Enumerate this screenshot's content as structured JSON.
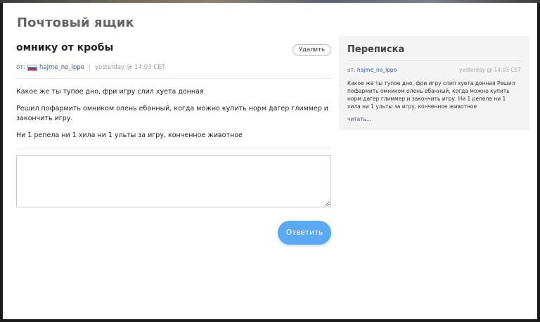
{
  "page": {
    "title": "Почтовый ящик"
  },
  "message": {
    "subject": "омнику от кробы",
    "delete_label": "Удалить",
    "from_label": "от:",
    "author": "hajme_no_ippo",
    "time": "yesterday @ 14:03 CET",
    "paragraphs": [
      "Какое же ты тупое дно, фри игру слил хуета донная",
      "Решил пофармить омником олень ебанный, когда можно купить норм дагер глиммер и закончить игру.",
      "Ни 1 репела ни 1 хила ни 1 ульты за игру, конченное животное"
    ]
  },
  "reply": {
    "text": "",
    "button_label": "Ответить"
  },
  "correspondence": {
    "title": "Переписка",
    "from_label": "от:",
    "author": "hajme_no_ippo",
    "time": "yesterday @ 14:03 CET",
    "preview": "Какое же ты тупое дно, фри игру слил хуета донная Решил пофармить омником олень ебанный, когда можно купить норм дагер глиммер и закончить игру. Ни 1 репела ни 1 хила ни 1 ульты за игру, конченное животное",
    "read_label": "читать..."
  },
  "colors": {
    "accent": "#5aa9f2",
    "link": "#2c5aa0",
    "sidebar_bg": "#f4f4f4"
  },
  "icons": {
    "flag": "russia-flag-icon",
    "grip": "resize-grip-icon"
  }
}
